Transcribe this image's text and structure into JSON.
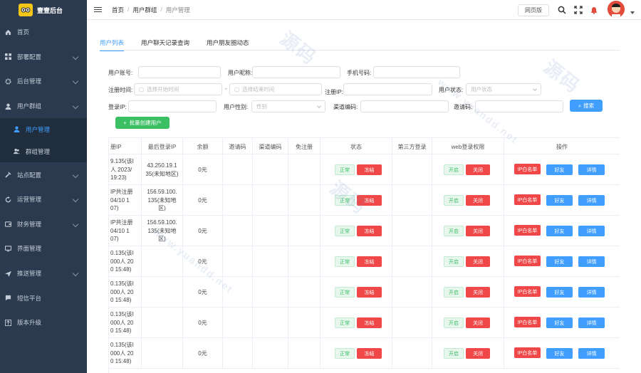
{
  "app": {
    "title": "壹壹后台"
  },
  "sidebar": {
    "items": [
      {
        "label": "首页",
        "icon": "home-icon",
        "arrow": false
      },
      {
        "label": "部署配置",
        "icon": "grid-icon",
        "arrow": true
      },
      {
        "label": "后台管理",
        "icon": "gear-icon",
        "arrow": true
      },
      {
        "label": "用户群组",
        "icon": "user-icon",
        "arrow": true
      },
      {
        "label": "用户管理",
        "icon": "user-icon",
        "sub": true,
        "active": true
      },
      {
        "label": "群组管理",
        "icon": "group-icon",
        "sub": true
      },
      {
        "label": "站点配置",
        "icon": "wrench-icon",
        "arrow": true
      },
      {
        "label": "运营管理",
        "icon": "refresh-icon",
        "arrow": true
      },
      {
        "label": "财务管理",
        "icon": "wallet-icon",
        "arrow": true
      },
      {
        "label": "界面管理",
        "icon": "monitor-icon",
        "arrow": false
      },
      {
        "label": "推送管理",
        "icon": "send-icon",
        "arrow": true
      },
      {
        "label": "短信平台",
        "icon": "chat-icon",
        "arrow": false
      },
      {
        "label": "版本升级",
        "icon": "upgrade-icon",
        "arrow": false
      }
    ]
  },
  "topbar": {
    "breadcrumb": [
      "首页",
      "用户群组",
      "用户管理"
    ],
    "web_button": "网页版"
  },
  "tabs": [
    "用户列表",
    "用户聊天记录查询",
    "用户朋友圈动态"
  ],
  "filters": {
    "account_label": "用户账号:",
    "nickname_label": "用户昵称:",
    "phone_label": "手机号码:",
    "reg_time_label": "注册时间:",
    "start_placeholder": "选择开始时间",
    "end_placeholder": "选择结束时间",
    "reg_ip_label": "注册IP:",
    "status_label": "用户状态:",
    "status_placeholder": "用户状态",
    "login_ip_label": "登录IP:",
    "gender_label": "用户性别:",
    "gender_placeholder": "性别",
    "channel_label": "渠道编码:",
    "invite_label": "邀请码:",
    "search_button": "搜索",
    "create_button": "批量创建用户"
  },
  "table": {
    "headers": [
      "册IP",
      "最后登录IP",
      "余额",
      "邀请码",
      "渠道编码",
      "免注册",
      "状态",
      "第三方登录",
      "web登录权限",
      "操作"
    ],
    "rows": [
      {
        "reg_ip": "9.135(该I\n人 2023/\n19:23)",
        "last_ip": "43.250.19.1\n35(未知地区)",
        "balance": "0元"
      },
      {
        "reg_ip": "IP共注册\n04/10 1\n07)",
        "last_ip": "156.59.100.\n135(未知地\n区)",
        "balance": "0元"
      },
      {
        "reg_ip": "IP共注册\n04/10 1\n07)",
        "last_ip": "156.59.100.\n135(未知地\n区)",
        "balance": "0元"
      },
      {
        "reg_ip": "0.135(该I\n000人 20\n0 15:48)",
        "last_ip": "",
        "balance": "0元"
      },
      {
        "reg_ip": "0.135(该I\n000人 20\n0 15:48)",
        "last_ip": "",
        "balance": "0元"
      },
      {
        "reg_ip": "0.135(该I\n000人 20\n0 15:48)",
        "last_ip": "",
        "balance": "0元"
      },
      {
        "reg_ip": "0.135(该I\n000人 20\n0 15:48)",
        "last_ip": "",
        "balance": "0元"
      }
    ],
    "status_normal": "正常",
    "status_freeze": "冻结",
    "web_open": "开启",
    "web_close": "关闭",
    "op_whitelist": "IP白名单",
    "op_friends": "好友",
    "op_detail": "详情"
  },
  "watermark": {
    "text": "源码",
    "url": "www.yuandd.net"
  }
}
